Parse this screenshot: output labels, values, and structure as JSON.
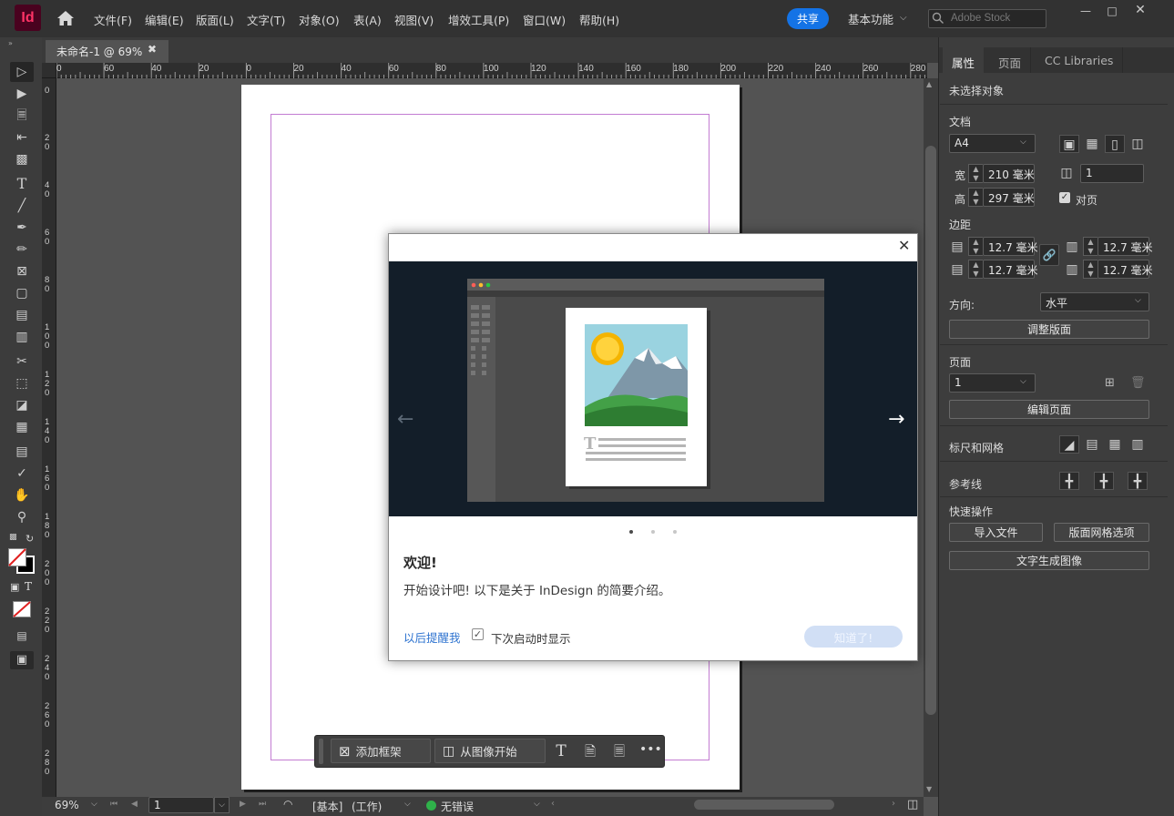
{
  "app": {
    "logo": "Id",
    "menu": [
      "文件(F)",
      "编辑(E)",
      "版面(L)",
      "文字(T)",
      "对象(O)",
      "表(A)",
      "视图(V)",
      "增效工具(P)",
      "窗口(W)",
      "帮助(H)"
    ],
    "share_label": "共享",
    "workspace_label": "基本功能",
    "search_placeholder": "Adobe Stock"
  },
  "document": {
    "tab_label": "未命名-1 @ 69%",
    "ruler_h_labels": [
      "0",
      "60",
      "40",
      "20",
      "0",
      "20",
      "40",
      "60",
      "80",
      "100",
      "120",
      "140",
      "160",
      "180",
      "200",
      "220",
      "240",
      "260",
      "280"
    ],
    "ruler_v_labels": [
      "0",
      "2 0",
      "4 0",
      "6 0",
      "8 0",
      "1 0 0",
      "1 2 0",
      "1 4 0",
      "1 6 0",
      "1 8 0",
      "2 0 0",
      "2 2 0",
      "2 4 0",
      "2 6 0",
      "2 8 0"
    ]
  },
  "context_bar": {
    "add_frame_label": "添加框架",
    "from_image_label": "从图像开始"
  },
  "status": {
    "zoom": "69%",
    "page": "1",
    "style": "[基本]",
    "mode": "(工作)",
    "preflight": "无错误",
    "preflight_color": "#2fb14a"
  },
  "panel": {
    "tabs": [
      "属性",
      "页面",
      "CC Libraries"
    ],
    "no_selection": "未选择对象",
    "document_section": "文档",
    "preset": "A4",
    "width_label": "宽",
    "width_value": "210 毫米",
    "height_label": "高",
    "height_value": "297 毫米",
    "pages_count": "1",
    "facing_pages_label": "对页",
    "margins_section": "边距",
    "margin_top": "12.7 毫米",
    "margin_bottom": "12.7 毫米",
    "margin_inside": "12.7 毫米",
    "margin_outside": "12.7 毫米",
    "orientation_label": "方向:",
    "orientation_value": "水平",
    "adjust_layout_button": "调整版面",
    "page_section": "页面",
    "page_value": "1",
    "edit_page_button": "编辑页面",
    "rulers_grids_label": "标尺和网格",
    "guides_label": "参考线",
    "quick_actions_label": "快速操作",
    "import_file_button": "导入文件",
    "layout_grid_button": "版面网格选项",
    "text_to_image_button": "文字生成图像"
  },
  "dialog": {
    "title": "欢迎!",
    "body": "开始设计吧! 以下是关于 InDesign 的简要介绍。",
    "remind_later": "以后提醒我",
    "show_next_label": "下次启动时显示",
    "show_next_checked": true,
    "ok_button": "知道了!",
    "slide_current": 1,
    "slide_total": 3
  }
}
